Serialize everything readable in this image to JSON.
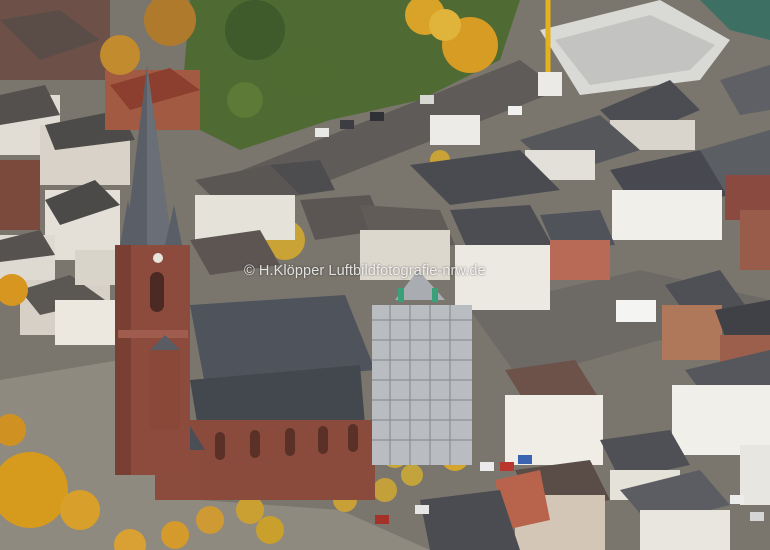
{
  "photo": {
    "watermark": "© H.Klöpper Luftbildfotografie-nrw.de"
  },
  "colors": {
    "brick": "#8a4a3c",
    "roof_slate": "#4f525a",
    "scaffold": "#b8bcc0",
    "autumn_tree": "#d99a1e",
    "green_tree": "#4d6b2f",
    "pavement": "#8f8a80"
  }
}
